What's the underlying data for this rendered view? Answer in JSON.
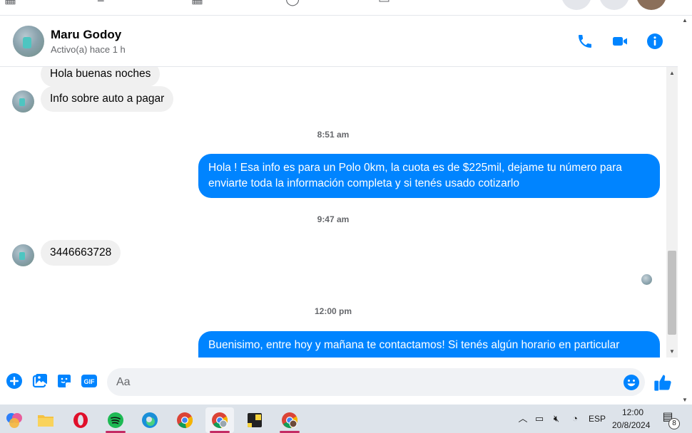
{
  "contact": {
    "name": "Maru Godoy",
    "status": "Activo(a) hace 1 h"
  },
  "header_actions": {
    "call": "phone-icon",
    "video": "video-icon",
    "info": "info-icon"
  },
  "messages": [
    {
      "type": "in",
      "text": "Hola buenas noches"
    },
    {
      "type": "in",
      "text": "Info sobre auto a pagar"
    },
    {
      "type": "time",
      "text": "8:51 am"
    },
    {
      "type": "out",
      "text": "Hola ! Esa info es para un Polo 0km, la cuota es de $225mil, dejame tu número para enviarte toda la información completa y si tenés usado cotizarlo"
    },
    {
      "type": "time",
      "text": "9:47 am"
    },
    {
      "type": "in",
      "text": "3446663728"
    },
    {
      "type": "time",
      "text": "12:00 pm"
    },
    {
      "type": "out",
      "text": "Buenisimo, entre hoy y mañana te contactamos! Si tenés algún horario en particular"
    }
  ],
  "composer": {
    "placeholder": "Aa"
  },
  "taskbar": {
    "language": "ESP",
    "time": "12:00",
    "date": "20/8/2024",
    "notification_count": "8"
  },
  "colors": {
    "accent": "#0084ff",
    "bubble_in": "#f0f0f0",
    "taskbar": "#dde3ea"
  }
}
